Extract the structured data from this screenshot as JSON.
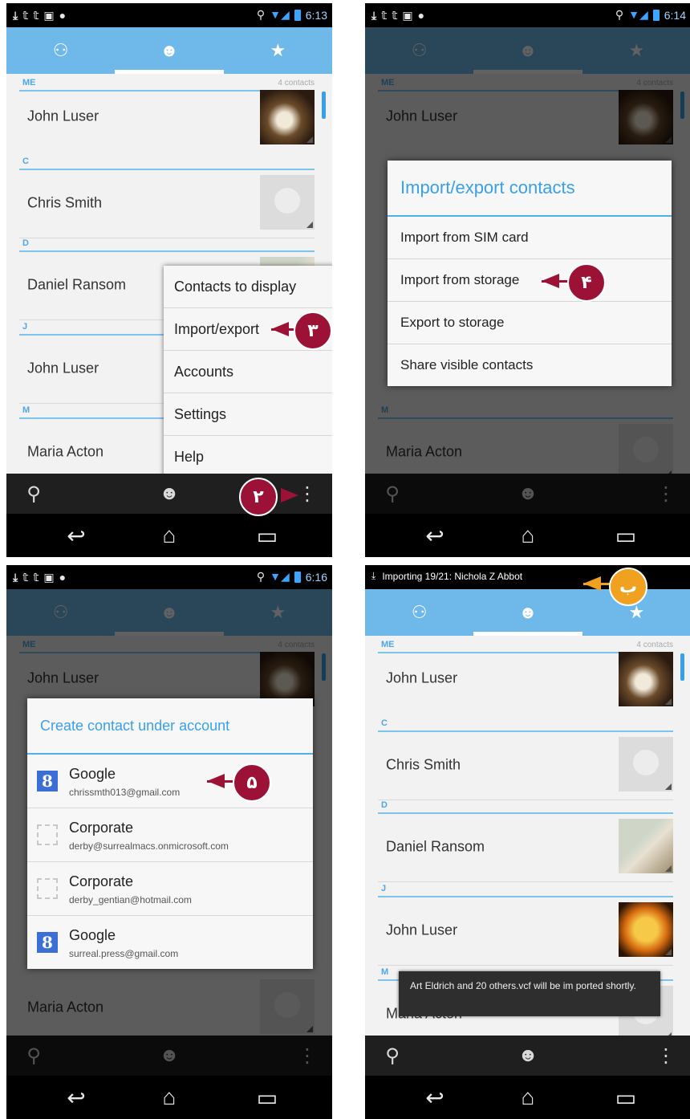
{
  "status": {
    "p1_time": "6:13",
    "p2_time": "6:14",
    "p3_time": "6:16",
    "p4_notification": "Importing 19/21: Nichola Z Abbot"
  },
  "tabs": [
    "groups-icon",
    "person-icon",
    "star-icon"
  ],
  "list": {
    "me_header": "ME",
    "me_count": "4 contacts",
    "sections": [
      "C",
      "D",
      "J",
      "M"
    ],
    "contacts": [
      "John Luser",
      "Chris Smith",
      "Daniel Ransom",
      "John Luser",
      "Maria Acton"
    ]
  },
  "menu": {
    "items": [
      "Contacts to display",
      "Import/export",
      "Accounts",
      "Settings",
      "Help"
    ]
  },
  "import_dialog": {
    "title": "Import/export contacts",
    "items": [
      "Import from SIM card",
      "Import from storage",
      "Export to storage",
      "Share visible contacts"
    ]
  },
  "account_dialog": {
    "title": "Create contact under account",
    "accounts": [
      {
        "type": "Google",
        "email": "chrissmth013@gmail.com",
        "icon": "google-icon"
      },
      {
        "type": "Corporate",
        "email": "derby@surrealmacs.onmicrosoft.com",
        "icon": "corporate-icon"
      },
      {
        "type": "Corporate",
        "email": "derby_gentian@hotmail.com",
        "icon": "corporate-icon"
      },
      {
        "type": "Google",
        "email": "surreal.press@gmail.com",
        "icon": "google-icon"
      }
    ]
  },
  "toast": "Art Eldrich and 20 others.vcf will be im ported shortly.",
  "callouts": {
    "c2": "٢",
    "c3": "٣",
    "c4": "۴",
    "c5": "۵",
    "cb": "ب"
  },
  "colors": {
    "tab_bar": "#6fb8ea",
    "accent": "#39a0e8",
    "callout_red": "#9c1236",
    "callout_orange": "#f0a11f"
  }
}
